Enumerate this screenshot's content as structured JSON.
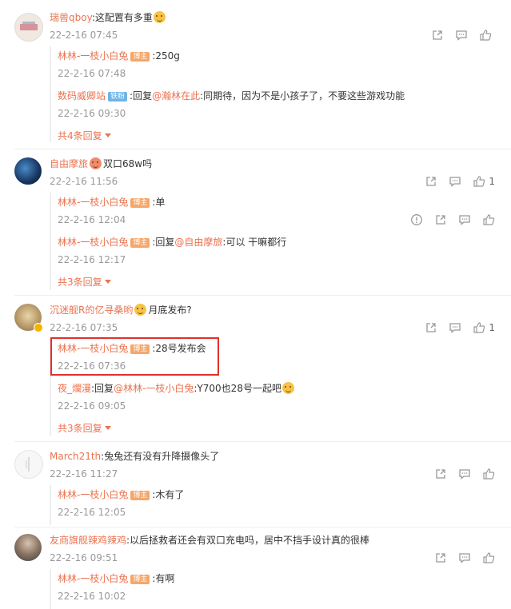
{
  "threads": [
    {
      "user": "瑞兽qboy",
      "text": ":这配置有多重",
      "time": "22-2-16 07:45",
      "likes": "",
      "replies": [
        {
          "user": "林林-一枝小白兔",
          "badge": "博主",
          "text": ":250g",
          "time": "22-2-16 07:48"
        },
        {
          "user": "数码威卿站",
          "badge": "铁粉",
          "prefix": ":回复",
          "mention": "@瀚林在此",
          "text": ":同期待，因为不是小孩子了，不要这些游戏功能",
          "time": "22-2-16 09:30"
        }
      ],
      "more": "共4条回复"
    },
    {
      "user": "自由摩旅",
      "text": "双口68w吗",
      "time": "22-2-16 11:56",
      "likes": "1",
      "replies": [
        {
          "user": "林林-一枝小白兔",
          "badge": "博主",
          "text": ":单",
          "time": "22-2-16 12:04"
        },
        {
          "user": "林林-一枝小白兔",
          "badge": "博主",
          "prefix": ":回复",
          "mention": "@自由摩旅",
          "text": ":可以 干嘛都行",
          "time": "22-2-16 12:17"
        }
      ],
      "more": "共3条回复"
    },
    {
      "user": "沉迷舰R的亿寻桑哟",
      "text": "月底发布?",
      "time": "22-2-16 07:35",
      "likes": "1",
      "replies": [
        {
          "user": "林林-一枝小白兔",
          "badge": "博主",
          "text": ":28号发布会",
          "time": "22-2-16 07:36"
        },
        {
          "user": "夜_爛漫",
          "prefix": ":回复",
          "mention": "@林林-一枝小白兔",
          "text": ":Y700也28号一起吧",
          "time": "22-2-16 09:05"
        }
      ],
      "more": "共3条回复"
    },
    {
      "user": "March21th",
      "text": ":兔兔还有没有升降摄像头了",
      "time": "22-2-16 11:27",
      "likes": "",
      "replies": [
        {
          "user": "林林-一枝小白兔",
          "badge": "博主",
          "text": ":木有了",
          "time": "22-2-16 12:05"
        }
      ]
    },
    {
      "user": "友商旗舰辣鸡辣鸡",
      "text": ":以后拯救者还会有双口充电吗，居中不挡手设计真的很棒",
      "time": "22-2-16 09:51",
      "likes": "",
      "replies": [
        {
          "user": "林林-一枝小白兔",
          "badge": "博主",
          "text": ":有啊",
          "time": "22-2-16 10:02"
        }
      ]
    }
  ],
  "colors": {
    "username": "#eb7350",
    "badge": "#f5a76b",
    "highlight": "#e0312b",
    "time": "#999999"
  },
  "icons": {
    "share": "share-icon",
    "comment": "comment-icon",
    "like": "like-icon",
    "report": "report-icon"
  }
}
